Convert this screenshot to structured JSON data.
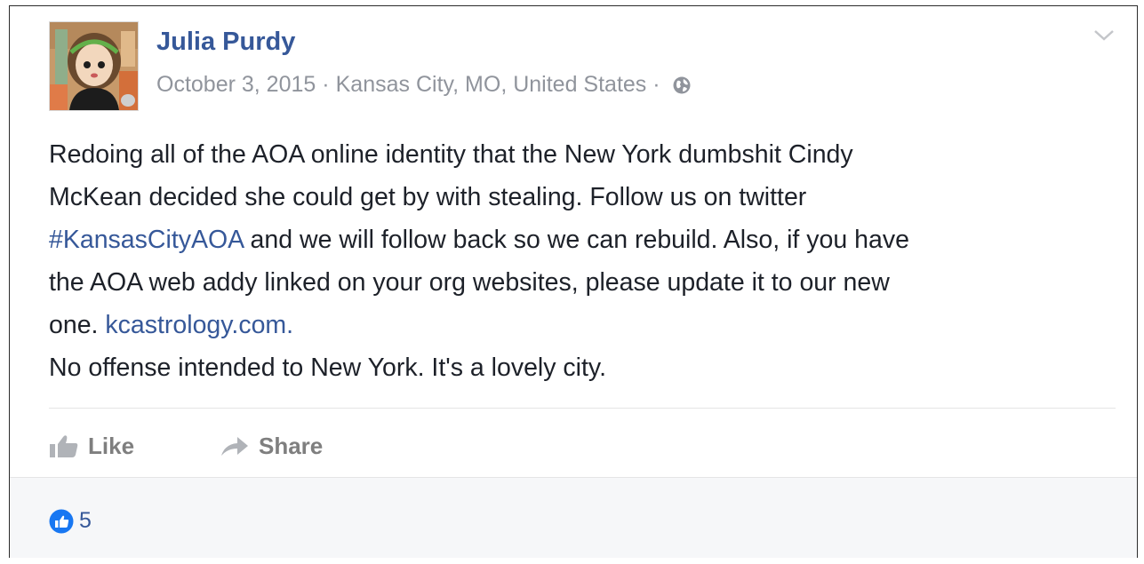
{
  "post": {
    "author": "Julia Purdy",
    "date": "October 3, 2015",
    "separator": "·",
    "location": "Kansas City, MO, United States",
    "privacy_separator": "·",
    "body": {
      "line1": "Redoing all of the AOA online identity that the New York dumbshit Cindy",
      "line2": "McKean decided she could get by with stealing. Follow us on twitter",
      "hashtag": "#KansasCityAOA",
      "line3_rest": " and we will follow back so we can rebuild. Also, if you have",
      "line4": "the AOA web addy linked on your org websites, please update it to our new",
      "line5_start": "one. ",
      "link": "kcastrology.com.",
      "line6": "No offense intended to New York. It's a lovely city."
    },
    "icons": {
      "avatar": "cartoon-avatar",
      "privacy": "globe-icon",
      "menu": "chevron-down-icon"
    }
  },
  "actions": {
    "like_label": "Like",
    "share_label": "Share"
  },
  "reactions": {
    "count": "5",
    "icon": "like-reaction-icon"
  },
  "colors": {
    "link": "#365899",
    "text": "#1d2129",
    "meta": "#90949c",
    "action": "#7f7f7f",
    "reaction_blue": "#1877f2",
    "footer_bg": "#f6f7f9"
  }
}
